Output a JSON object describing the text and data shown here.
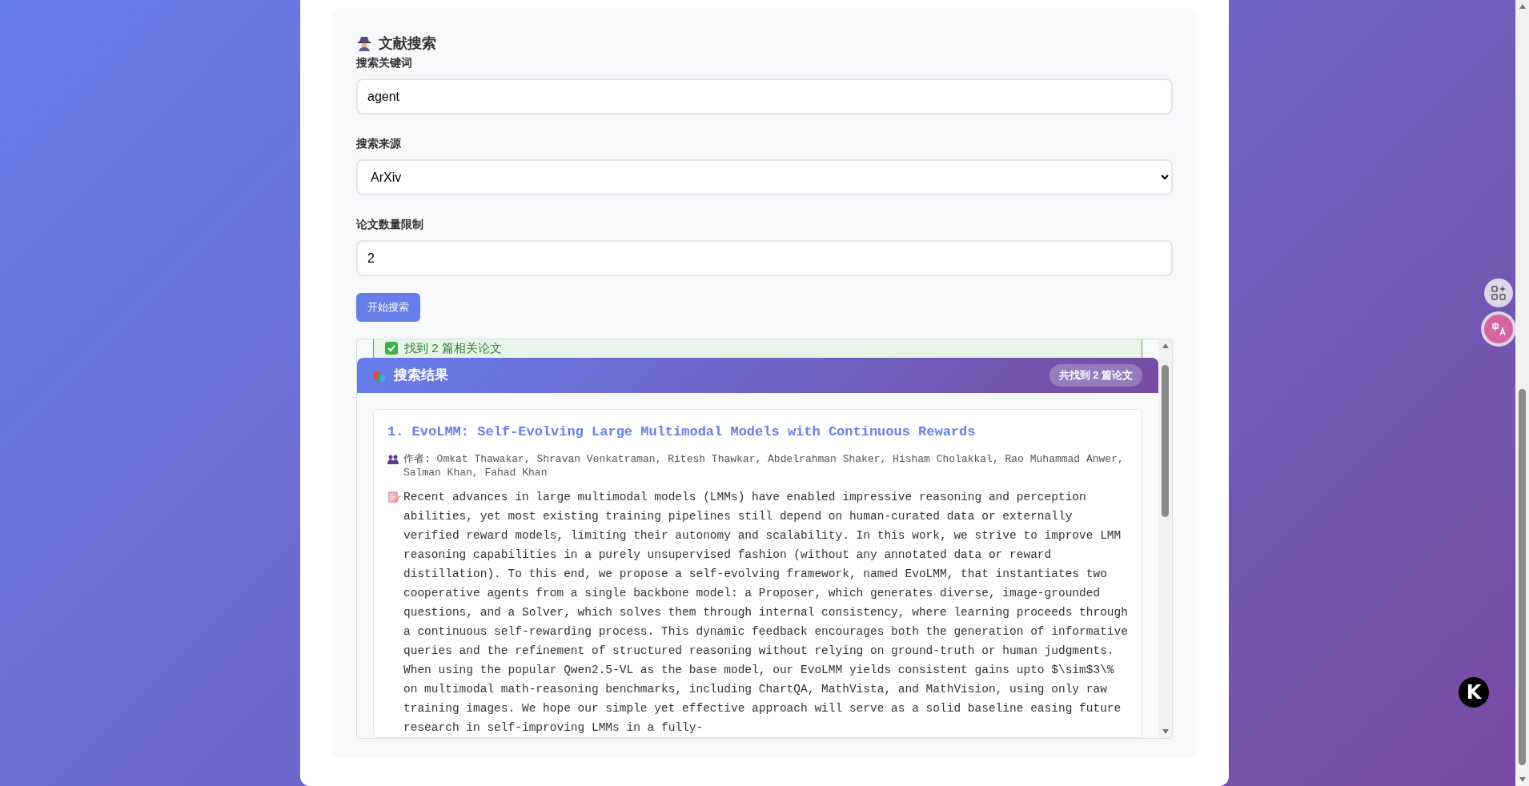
{
  "header": {
    "title": "文献搜索"
  },
  "form": {
    "fields": [
      {
        "kind": "text",
        "label": "搜索关键词",
        "value": "agent"
      },
      {
        "kind": "select",
        "label": "搜索来源",
        "value": "ArXiv"
      },
      {
        "kind": "text",
        "label": "论文数量限制",
        "value": "2"
      }
    ],
    "submit": "开始搜索"
  },
  "results": {
    "status": "找到 2 篇相关论文",
    "title": "搜索结果",
    "count_badge": "共找到 2 篇论文",
    "papers": [
      {
        "title": "1. EvoLMM: Self-Evolving Large Multimodal Models with Continuous Rewards",
        "authors": "作者: Omkat Thawakar, Shravan Venkatraman, Ritesh Thawkar, Abdelrahman Shaker, Hisham Cholakkal, Rao Muhammad Anwer, Salman Khan, Fahad Khan",
        "abstract": "Recent advances in large multimodal models (LMMs) have enabled impressive reasoning and perception abilities, yet most existing training pipelines still depend on human-curated data or externally verified reward models, limiting their autonomy and scalability. In this work, we strive to improve LMM reasoning capabilities in a purely unsupervised fashion (without any annotated data or reward distillation). To this end, we propose a self-evolving framework, named EvoLMM, that instantiates two cooperative agents from a single backbone model: a Proposer, which generates diverse, image-grounded questions, and a Solver, which solves them through internal consistency, where learning proceeds through a continuous self-rewarding process. This dynamic feedback encourages both the generation of informative queries and the refinement of structured reasoning without relying on ground-truth or human judgments. When using the popular Qwen2.5-VL as the base model, our EvoLMM yields consistent gains upto $\\sim$3\\% on multimodal math-reasoning benchmarks, including ChartQA, MathVista, and MathVision, using only raw training images. We hope our simple yet effective approach will serve as a solid baseline easing future research in self-improving LMMs in a fully-"
      }
    ]
  },
  "floating_widgets": {
    "logo_letter": "K"
  }
}
